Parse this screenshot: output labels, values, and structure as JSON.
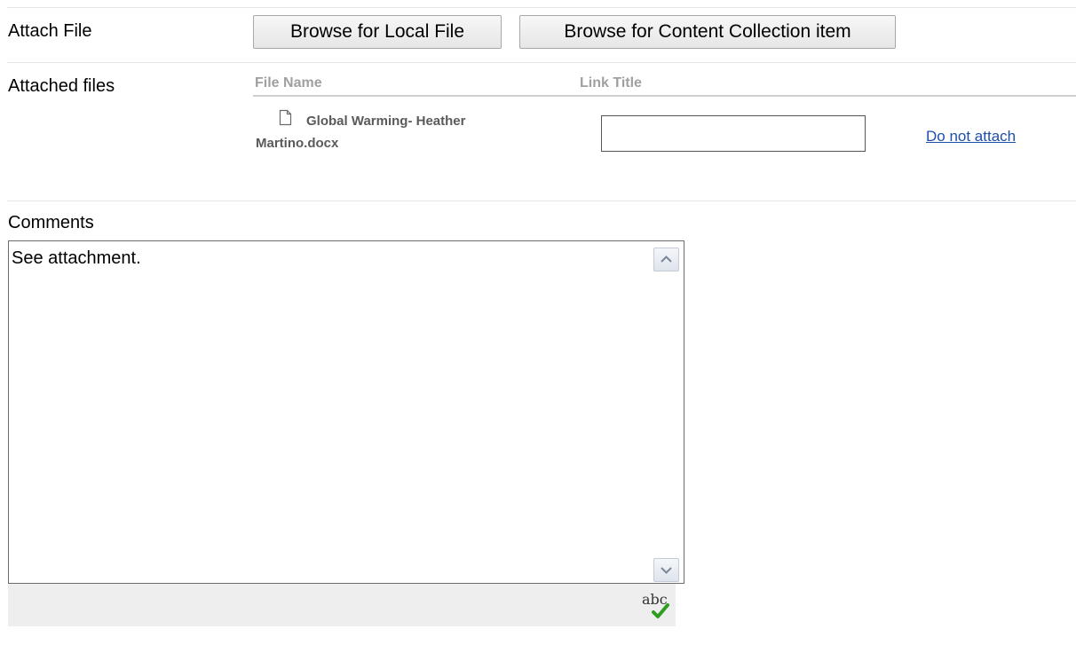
{
  "attach_file": {
    "label": "Attach File",
    "browse_local_label": "Browse for Local File",
    "browse_collection_label": "Browse for Content Collection item"
  },
  "attached_files": {
    "label": "Attached files",
    "columns": [
      "File Name",
      "Link Title"
    ],
    "rows": [
      {
        "icon": "document-icon",
        "file_name": "Global Warming- Heather Martino.docx",
        "link_title_value": "",
        "action_label": "Do not attach"
      }
    ]
  },
  "comments": {
    "label": "Comments",
    "value": "See attachment.",
    "spellcheck_icon": "spellcheck-icon",
    "spellcheck_text": "abc"
  },
  "colors": {
    "link": "#1f4ea8",
    "column_header": "#a0a0a0",
    "footer_bar": "#eeeeee",
    "checkmark": "#2e9e1f"
  }
}
